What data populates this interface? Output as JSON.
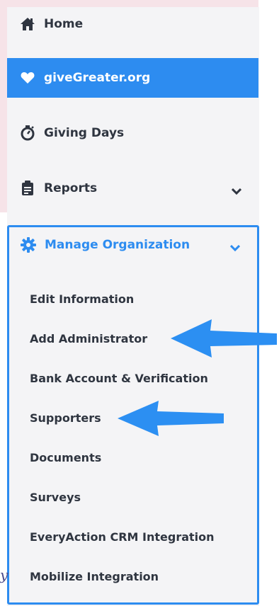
{
  "nav": {
    "home": "Home",
    "givegreater": "giveGreater.org",
    "giving_days": "Giving Days",
    "reports": "Reports"
  },
  "manage": {
    "label": "Manage Organization",
    "items": [
      "Edit Information",
      "Add Administrator",
      "Bank Account & Verification",
      "Supporters",
      "Documents",
      "Surveys",
      "EveryAction CRM Integration",
      "Mobilize Integration"
    ]
  },
  "edge_text": "y",
  "colors": {
    "accent": "#2d8cf0",
    "text": "#2f3540",
    "sidebar_bg": "#f4f4f6",
    "page_bg": "#f6e3e8"
  },
  "icons": {
    "home": "home-icon",
    "givegreater": "heart-icon",
    "giving_days": "stopwatch-icon",
    "reports": "clipboard-icon",
    "manage": "gear-icon",
    "chevron": "chevron-down-icon",
    "annotation": "arrow-left-icon"
  }
}
